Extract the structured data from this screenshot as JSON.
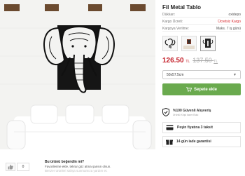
{
  "product": {
    "title": "Fil Metal Tablo",
    "meta": [
      {
        "key": "Dükkan:",
        "value": "oxidepo",
        "accent": false
      },
      {
        "key": "Kargo Ücreti:",
        "value": "Ücretsiz Kargo",
        "accent": true
      },
      {
        "key": "Kargoya Verilme:",
        "value": "Maks. 7 iş günü",
        "accent": false
      }
    ],
    "price": "126.50",
    "old_price": "137.50",
    "currency": "TL",
    "size_select": {
      "selected": "50x57.5cm"
    },
    "cart_button_label": "Sepete ekle"
  },
  "trust": {
    "guarantee_title": "%100 Güvenli Alışveriş",
    "guarantee_sub": "Ürünlü Köşk lazım Bulu",
    "features": [
      {
        "icon": "credit-card-icon",
        "label": "Peşin fiyatına 3 taksit"
      },
      {
        "icon": "gift-box-icon",
        "label": "14 gün iade garantisi"
      }
    ]
  },
  "review": {
    "vote_count": "0",
    "question": "Bu ürünü beğendin mi?",
    "line1": "Favorilerine ekle, tekrar göz atma şansın olsun.",
    "line2": "Benzer ürünleri sahşa sunmamıza yardım et."
  },
  "colors": {
    "price_red": "#c4202a",
    "cart_green": "#6aaa4e",
    "shipping_red": "#d7262b"
  }
}
